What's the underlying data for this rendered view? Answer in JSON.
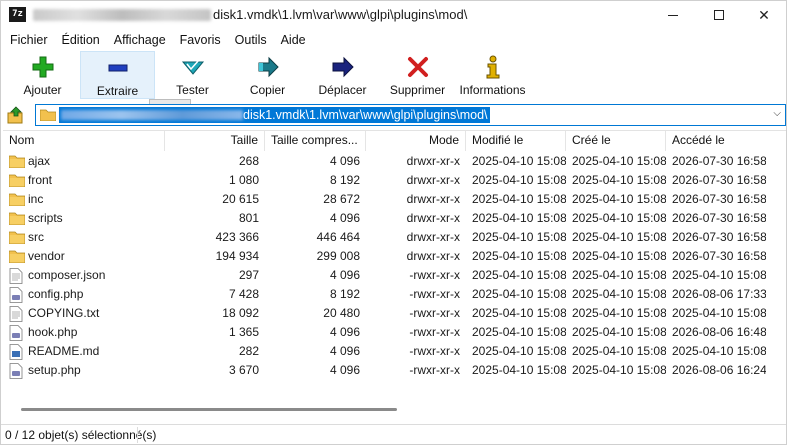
{
  "window": {
    "title": "disk1.vmdk\\1.lvm\\var\\www\\glpi\\plugins\\mod\\",
    "app_icon": "7z"
  },
  "menu": [
    "Fichier",
    "Édition",
    "Affichage",
    "Favoris",
    "Outils",
    "Aide"
  ],
  "toolbar": [
    {
      "label": "Ajouter",
      "icon": "plus-icon",
      "color": "#22aa22"
    },
    {
      "label": "Extraire",
      "icon": "minus-icon",
      "color": "#1f3fbf"
    },
    {
      "label": "Tester",
      "icon": "check-icon",
      "color": "#1fa7b8"
    },
    {
      "label": "Copier",
      "icon": "copy-arrow-icon",
      "color": "#1a7a8a"
    },
    {
      "label": "Déplacer",
      "icon": "move-arrow-icon",
      "color": "#1a237e"
    },
    {
      "label": "Supprimer",
      "icon": "delete-x-icon",
      "color": "#d11f1f"
    },
    {
      "label": "Informations",
      "icon": "info-icon",
      "color": "#e0b000"
    }
  ],
  "address": {
    "path": "disk1.vmdk\\1.lvm\\var\\www\\glpi\\plugins\\mod\\",
    "selection_color": "#0078d7"
  },
  "columns": [
    "Nom",
    "Taille",
    "Taille compres...",
    "Mode",
    "Modifié le",
    "Créé le",
    "Accédé le"
  ],
  "rows": [
    {
      "name": "ajax",
      "type": "folder",
      "size": "268",
      "packed": "4 096",
      "mode": "drwxr-xr-x",
      "modified": "2025-04-10 15:08",
      "created": "2025-04-10 15:08",
      "accessed": "2026-07-30 16:58"
    },
    {
      "name": "front",
      "type": "folder",
      "size": "1 080",
      "packed": "8 192",
      "mode": "drwxr-xr-x",
      "modified": "2025-04-10 15:08",
      "created": "2025-04-10 15:08",
      "accessed": "2026-07-30 16:58"
    },
    {
      "name": "inc",
      "type": "folder",
      "size": "20 615",
      "packed": "28 672",
      "mode": "drwxr-xr-x",
      "modified": "2025-04-10 15:08",
      "created": "2025-04-10 15:08",
      "accessed": "2026-07-30 16:58"
    },
    {
      "name": "scripts",
      "type": "folder",
      "size": "801",
      "packed": "4 096",
      "mode": "drwxr-xr-x",
      "modified": "2025-04-10 15:08",
      "created": "2025-04-10 15:08",
      "accessed": "2026-07-30 16:58"
    },
    {
      "name": "src",
      "type": "folder",
      "size": "423 366",
      "packed": "446 464",
      "mode": "drwxr-xr-x",
      "modified": "2025-04-10 15:08",
      "created": "2025-04-10 15:08",
      "accessed": "2026-07-30 16:58"
    },
    {
      "name": "vendor",
      "type": "folder",
      "size": "194 934",
      "packed": "299 008",
      "mode": "drwxr-xr-x",
      "modified": "2025-04-10 15:08",
      "created": "2025-04-10 15:08",
      "accessed": "2026-07-30 16:58"
    },
    {
      "name": "composer.json",
      "type": "file",
      "size": "297",
      "packed": "4 096",
      "mode": "-rwxr-xr-x",
      "modified": "2025-04-10 15:08",
      "created": "2025-04-10 15:08",
      "accessed": "2025-04-10 15:08"
    },
    {
      "name": "config.php",
      "type": "php",
      "size": "7 428",
      "packed": "8 192",
      "mode": "-rwxr-xr-x",
      "modified": "2025-04-10 15:08",
      "created": "2025-04-10 15:08",
      "accessed": "2026-08-06 17:33"
    },
    {
      "name": "COPYING.txt",
      "type": "file",
      "size": "18 092",
      "packed": "20 480",
      "mode": "-rwxr-xr-x",
      "modified": "2025-04-10 15:08",
      "created": "2025-04-10 15:08",
      "accessed": "2025-04-10 15:08"
    },
    {
      "name": "hook.php",
      "type": "php",
      "size": "1 365",
      "packed": "4 096",
      "mode": "-rwxr-xr-x",
      "modified": "2025-04-10 15:08",
      "created": "2025-04-10 15:08",
      "accessed": "2026-08-06 16:48"
    },
    {
      "name": "README.md",
      "type": "md",
      "size": "282",
      "packed": "4 096",
      "mode": "-rwxr-xr-x",
      "modified": "2025-04-10 15:08",
      "created": "2025-04-10 15:08",
      "accessed": "2025-04-10 15:08"
    },
    {
      "name": "setup.php",
      "type": "php",
      "size": "3 670",
      "packed": "4 096",
      "mode": "-rwxr-xr-x",
      "modified": "2025-04-10 15:08",
      "created": "2025-04-10 15:08",
      "accessed": "2026-08-06 16:24"
    }
  ],
  "status": {
    "selection": "0 / 12 objet(s) sélectionné(s)"
  },
  "colors": {
    "folder": "#f2c14e",
    "accent": "#0078d4",
    "hover": "#e5f1fb"
  }
}
